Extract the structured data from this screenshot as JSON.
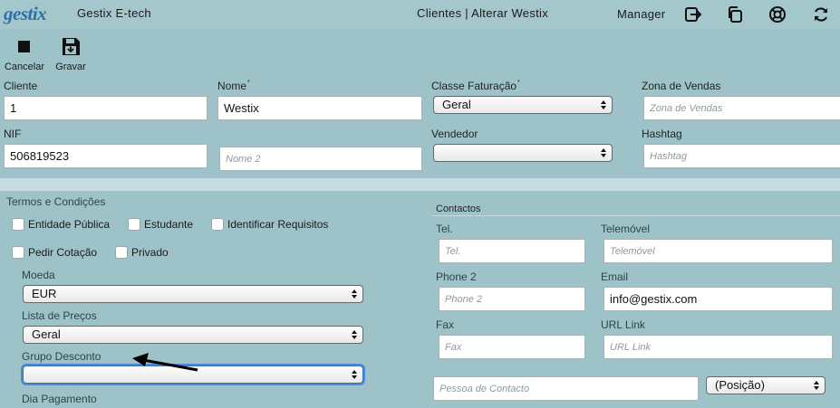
{
  "header": {
    "logo": "gestix",
    "app_name": "Gestix E-tech",
    "page_title": "Clientes | Alterar Westix",
    "user": "Manager",
    "icons": [
      "logout-icon",
      "copy-icon",
      "help-lifebuoy-icon",
      "refresh-icon"
    ]
  },
  "toolbar": {
    "cancel_label": "Cancelar",
    "save_label": "Gravar"
  },
  "form": {
    "cliente": {
      "label": "Cliente",
      "value": "1"
    },
    "nome": {
      "label": "Nome",
      "value": "Westix",
      "required_mark": "*"
    },
    "classe_faturacao": {
      "label": "Classe Faturação",
      "value": "Geral",
      "required_mark": "*"
    },
    "zona_vendas": {
      "label": "Zona de Vendas",
      "placeholder": "Zona de Vendas"
    },
    "nif": {
      "label": "NIF",
      "value": "506819523"
    },
    "nome2": {
      "placeholder": "Nome 2"
    },
    "vendedor": {
      "label": "Vendedor",
      "value": ""
    },
    "hashtag": {
      "label": "Hashtag",
      "placeholder": "Hashtag"
    }
  },
  "terms": {
    "title": "Termos e Condições",
    "checkboxes": {
      "entidade_publica": "Entidade Pública",
      "estudante": "Estudante",
      "identificar_requisitos": "Identificar Requisitos",
      "pedir_cotacao": "Pedir Cotação",
      "privado": "Privado"
    },
    "moeda": {
      "label": "Moeda",
      "value": "EUR"
    },
    "lista_precos": {
      "label": "Lista de Preços",
      "value": "Geral"
    },
    "grupo_desconto": {
      "label": "Grupo Desconto",
      "value": ""
    },
    "dia_pagamento": {
      "label": "Dia Pagamento"
    }
  },
  "contacts": {
    "title": "Contactos",
    "tel": {
      "label": "Tel.",
      "placeholder": "Tel."
    },
    "telemovel": {
      "label": "Telemóvel",
      "placeholder": "Telemóvel"
    },
    "phone2": {
      "label": "Phone 2",
      "placeholder": "Phone 2"
    },
    "email": {
      "label": "Email",
      "value": "info@gestix.com"
    },
    "fax": {
      "label": "Fax",
      "placeholder": "Fax"
    },
    "url": {
      "label": "URL Link",
      "placeholder": "URL Link"
    },
    "pessoa": {
      "placeholder": "Pessoa de Contacto"
    },
    "posicao": {
      "value": "(Posição)"
    }
  },
  "colors": {
    "background": "#9dc3c8",
    "band": "#c5dde0",
    "logo": "#2f6fb0",
    "focus_ring": "#4e89d6"
  }
}
